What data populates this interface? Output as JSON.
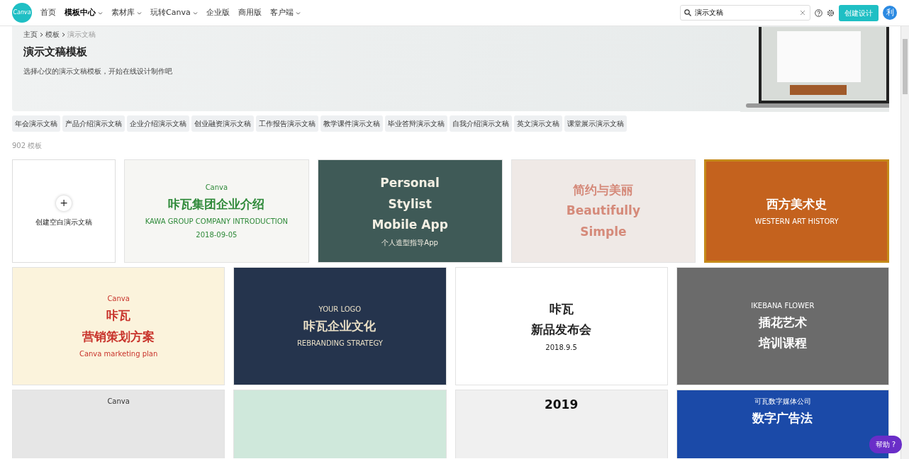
{
  "navbar": {
    "logo": "Canva",
    "items": [
      {
        "label": "首页",
        "selected": false,
        "dropdown": false
      },
      {
        "label": "模板中心",
        "selected": true,
        "dropdown": true
      },
      {
        "label": "素材库",
        "selected": false,
        "dropdown": true
      },
      {
        "label": "玩转Canva",
        "selected": false,
        "dropdown": true
      },
      {
        "label": "企业版",
        "selected": false,
        "dropdown": false
      },
      {
        "label": "商用版",
        "selected": false,
        "dropdown": false
      },
      {
        "label": "客户端",
        "selected": false,
        "dropdown": true
      }
    ],
    "search": {
      "value": "演示文稿"
    },
    "create_button": "创建设计",
    "avatar": "利"
  },
  "breadcrumb": [
    "主页",
    "模板",
    "演示文稿"
  ],
  "banner": {
    "title": "演示文稿模板",
    "subtitle": "选择心仪的演示文稿模板，开始在线设计制作吧"
  },
  "tags": [
    "年会演示文稿",
    "产品介绍演示文稿",
    "企业介绍演示文稿",
    "创业融资演示文稿",
    "工作报告演示文稿",
    "教学课件演示文稿",
    "毕业答辩演示文稿",
    "自我介绍演示文稿",
    "英文演示文稿",
    "课堂展示演示文稿"
  ],
  "count": "902 模板",
  "blank_card": {
    "icon": "+",
    "label": "创建空白演示文稿"
  },
  "templates": [
    {
      "kind": "floral",
      "selected": false,
      "lines": [
        "Canva",
        "咔瓦集团企业介绍",
        "KAWA GROUP COMPANY INTRODUCTION",
        "2018-09-05"
      ]
    },
    {
      "kind": "stylist",
      "selected": false,
      "lines": [
        "Personal",
        "Stylist",
        "Mobile App",
        "个人造型指导App"
      ]
    },
    {
      "kind": "simple",
      "selected": false,
      "lines": [
        "简约与美丽",
        "Beautifully",
        "Simple"
      ]
    },
    {
      "kind": "art",
      "selected": true,
      "lines": [
        "西方美术史",
        "WESTERN ART HISTORY"
      ]
    },
    {
      "kind": "marketing",
      "selected": false,
      "lines": [
        "Canva",
        "咔瓦",
        "营销策划方案",
        "Canva marketing plan"
      ]
    },
    {
      "kind": "navy",
      "selected": false,
      "lines": [
        "YOUR LOGO",
        "咔瓦企业文化",
        "REBRANDING STRATEGY"
      ]
    },
    {
      "kind": "launch",
      "selected": false,
      "lines": [
        "咔瓦",
        "新品发布会",
        "2018.9.5"
      ]
    },
    {
      "kind": "flower",
      "selected": false,
      "lines": [
        "IKEBANA FLOWER",
        "插花艺术",
        "培训课程"
      ]
    },
    {
      "kind": "grey",
      "selected": false,
      "lines": [
        "Canva"
      ]
    },
    {
      "kind": "mint",
      "selected": false
    },
    {
      "kind": "report",
      "selected": false,
      "lines": [
        "2019"
      ]
    },
    {
      "kind": "digital",
      "selected": false,
      "lines": [
        "可瓦数字媒体公司",
        "数字广告法"
      ]
    }
  ],
  "help_button": "帮助 ?"
}
